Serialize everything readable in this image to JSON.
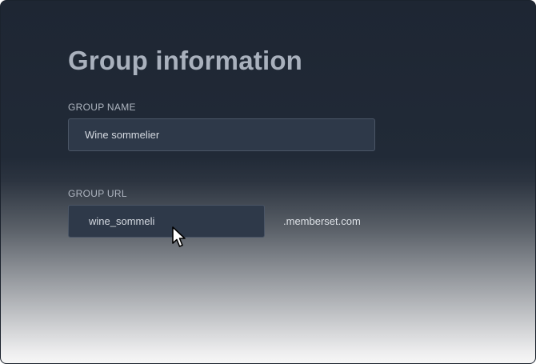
{
  "page": {
    "title": "Group information"
  },
  "group_name": {
    "label": "GROUP NAME",
    "value": "Wine sommelier"
  },
  "group_url": {
    "label": "GROUP URL",
    "value": "wine_sommeli",
    "suffix": ".memberset.com"
  },
  "icons": {
    "cursor": "arrow-pointer-icon"
  },
  "colors": {
    "background_top": "#1e2633",
    "input_background": "#2e3949",
    "title": "#a9b1bd"
  }
}
